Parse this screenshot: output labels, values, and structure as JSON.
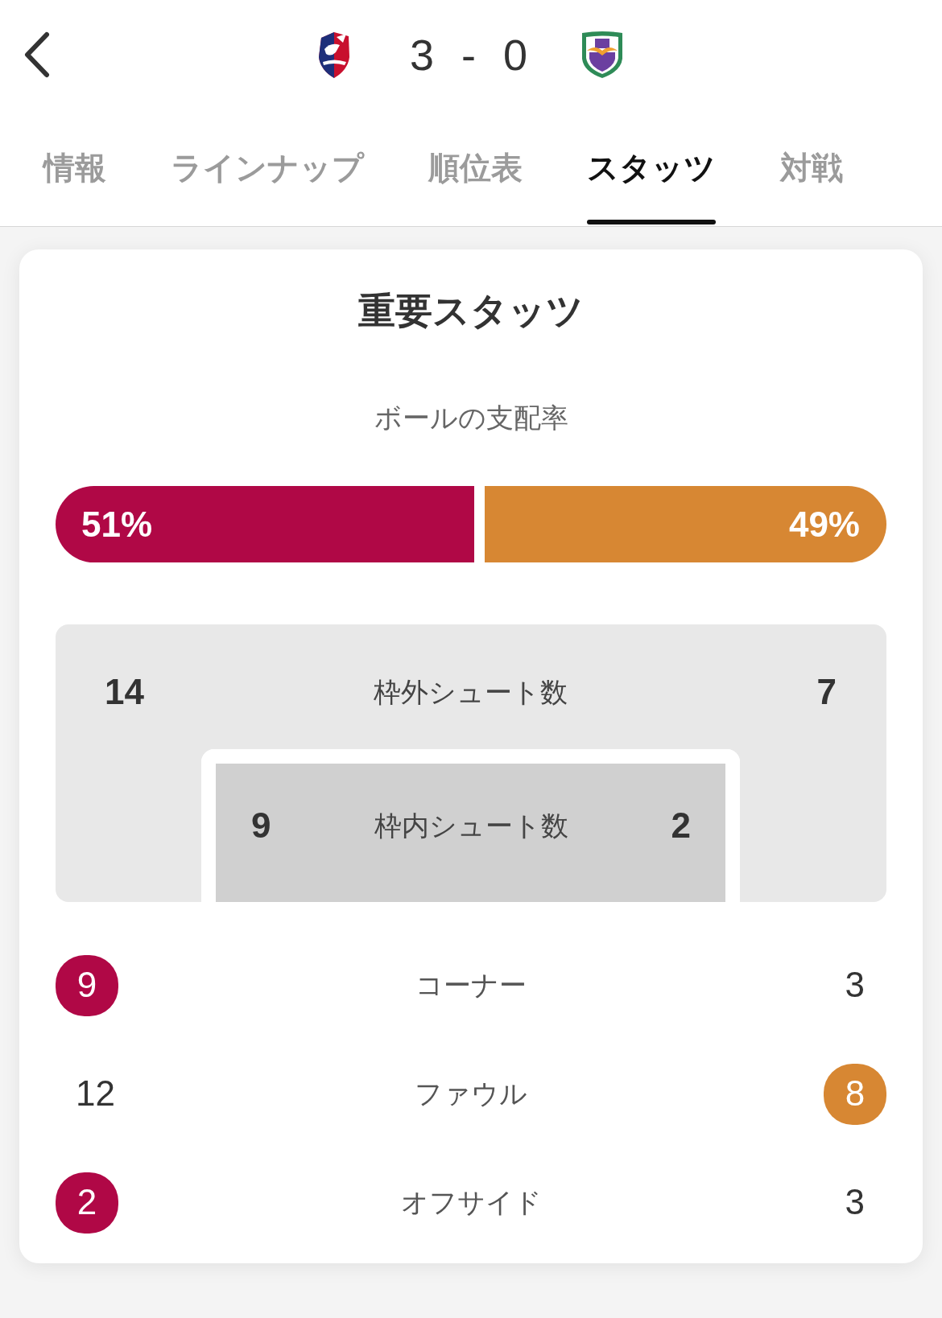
{
  "header": {
    "score": {
      "home": "3",
      "separator": "-",
      "away": "0"
    }
  },
  "tabs": [
    {
      "label": "情報",
      "selected": false
    },
    {
      "label": "ラインナップ",
      "selected": false
    },
    {
      "label": "順位表",
      "selected": false
    },
    {
      "label": "スタッツ",
      "selected": true
    },
    {
      "label": "対戦",
      "selected": false
    }
  ],
  "teams": [
    {
      "color": "#b00846"
    },
    {
      "color": "#d78733"
    }
  ],
  "key_stats": {
    "title": "重要スタッツ",
    "possession": {
      "label": "ボールの支配率",
      "home": {
        "value": "51%",
        "level": 0.51
      },
      "away": {
        "value": "49%",
        "level": 0.49
      }
    },
    "shots": {
      "off_target": {
        "label": "枠外シュート数",
        "home": "14",
        "away": "7"
      },
      "on_target": {
        "label": "枠内シュート数",
        "home": "9",
        "away": "2"
      }
    },
    "rows": [
      {
        "label": "コーナー",
        "home": {
          "value": "9",
          "highlighted": true
        },
        "away": {
          "value": "3",
          "highlighted": false
        }
      },
      {
        "label": "ファウル",
        "home": {
          "value": "12",
          "highlighted": false
        },
        "away": {
          "value": "8",
          "highlighted": true
        }
      },
      {
        "label": "オフサイド",
        "home": {
          "value": "2",
          "highlighted": true
        },
        "away": {
          "value": "3",
          "highlighted": false
        }
      }
    ]
  }
}
